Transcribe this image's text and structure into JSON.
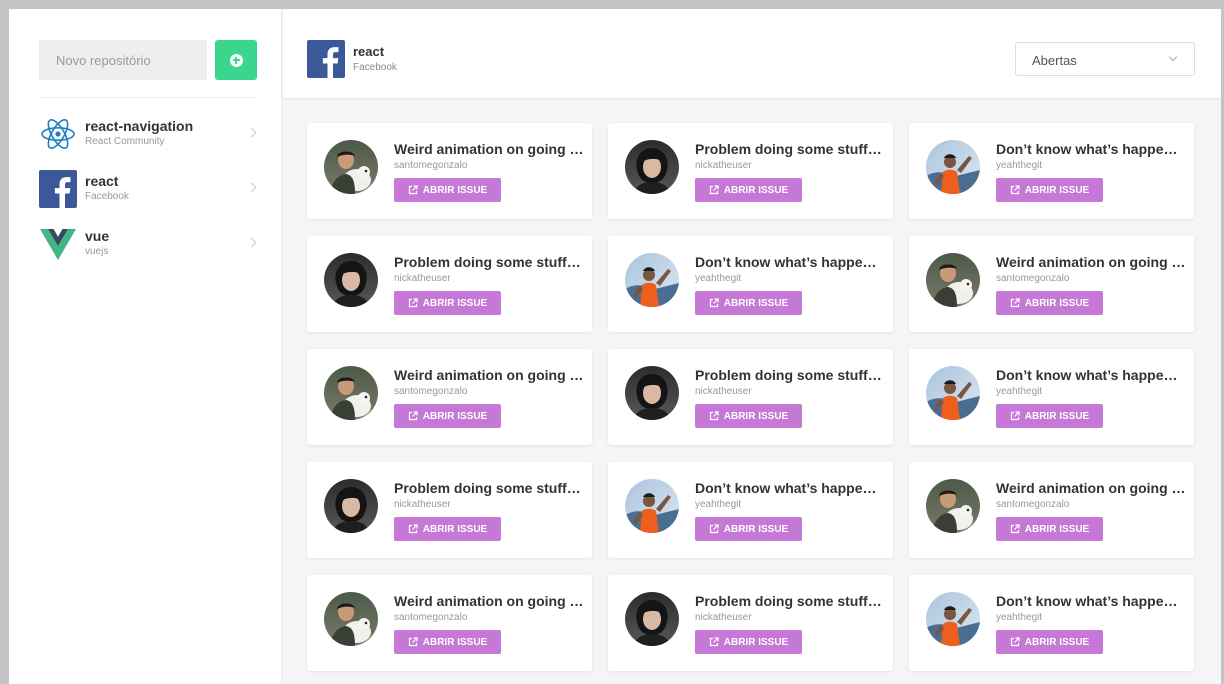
{
  "sidebar": {
    "new_repo_placeholder": "Novo repositório",
    "add_icon": "plus-circle-icon",
    "repos": [
      {
        "name": "react-navigation",
        "owner": "React Community",
        "logo": "react-atom-icon"
      },
      {
        "name": "react",
        "owner": "Facebook",
        "logo": "facebook-icon"
      },
      {
        "name": "vue",
        "owner": "vuejs",
        "logo": "vue-icon"
      }
    ]
  },
  "header": {
    "repo_name": "react",
    "repo_owner": "Facebook",
    "filter_selected": "Abertas"
  },
  "issues": {
    "button_label": "ABRIR ISSUE",
    "items": [
      {
        "title": "Weird animation on going back",
        "user": "santomegonzalo"
      },
      {
        "title": "Problem doing some stuff with react",
        "user": "nickatheuser"
      },
      {
        "title": "Don’t know what’s happening here",
        "user": "yeahthegit"
      },
      {
        "title": "Problem doing some stuff with react",
        "user": "nickatheuser"
      },
      {
        "title": "Don’t know what’s happening here",
        "user": "yeahthegit"
      },
      {
        "title": "Weird animation on going back",
        "user": "santomegonzalo"
      },
      {
        "title": "Weird animation on going back",
        "user": "santomegonzalo"
      },
      {
        "title": "Problem doing some stuff with react",
        "user": "nickatheuser"
      },
      {
        "title": "Don’t know what’s happening here",
        "user": "yeahthegit"
      },
      {
        "title": "Problem doing some stuff with react",
        "user": "nickatheuser"
      },
      {
        "title": "Don’t know what’s happening here",
        "user": "yeahthegit"
      },
      {
        "title": "Weird animation on going back",
        "user": "santomegonzalo"
      },
      {
        "title": "Weird animation on going back",
        "user": "santomegonzalo"
      },
      {
        "title": "Problem doing some stuff with react",
        "user": "nickatheuser"
      },
      {
        "title": "Don’t know what’s happening here",
        "user": "yeahthegit"
      }
    ]
  },
  "colors": {
    "accent_green": "#3ad68e",
    "button_purple": "#c678d6",
    "facebook_blue": "#3b5998",
    "react_blue": "#1f7ec4",
    "vue_green": "#41b883",
    "vue_dark": "#35495e"
  }
}
